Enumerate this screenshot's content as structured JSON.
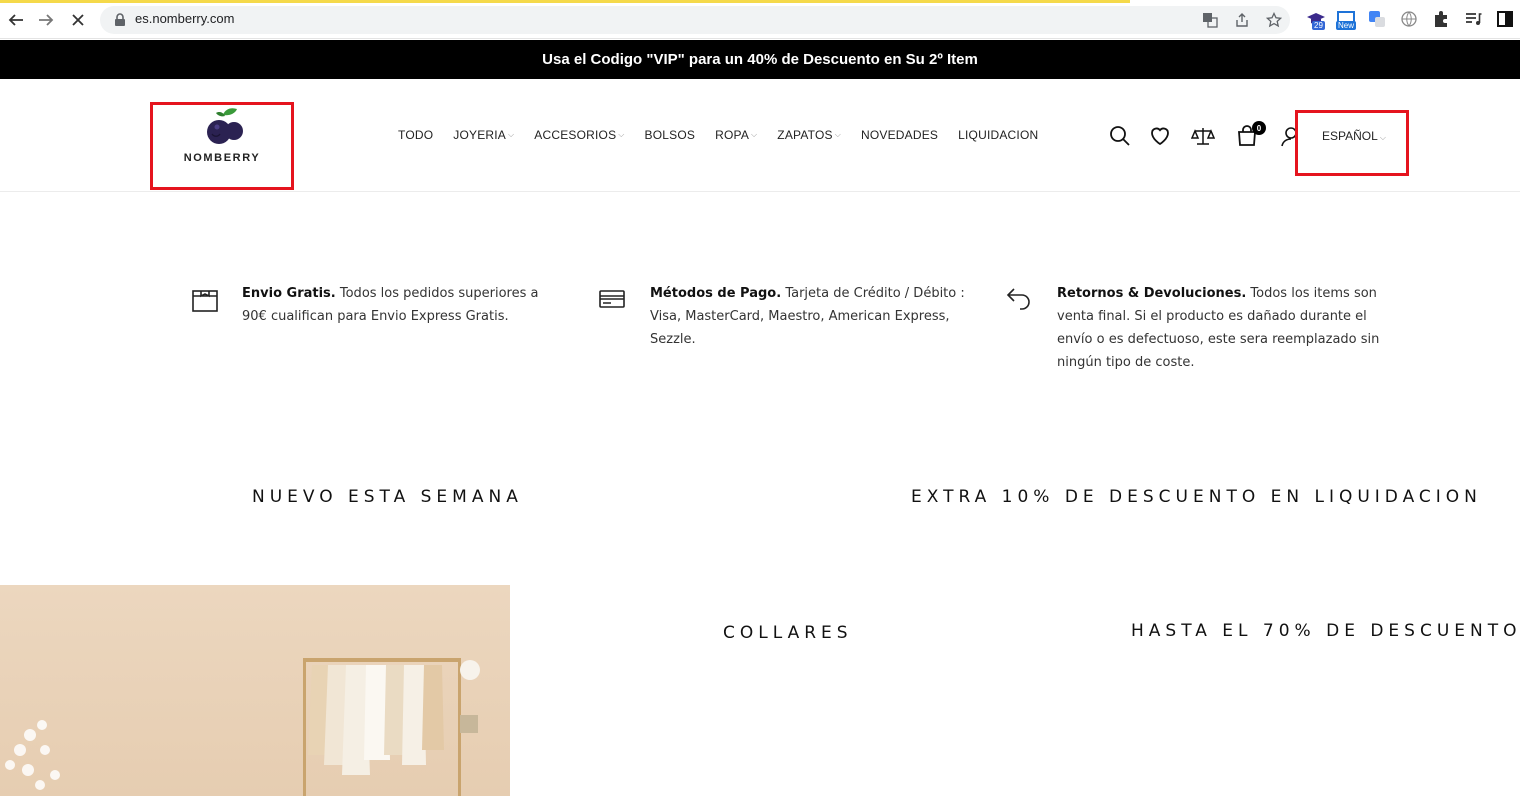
{
  "browser": {
    "url": "es.nomberry.com",
    "extension_badges": {
      "count": "29",
      "new": "New"
    }
  },
  "promo": {
    "text": "Usa el Codigo \"VIP\" para un 40% de Descuento en Su 2º Item"
  },
  "header": {
    "logo_text": "NOMBERRY",
    "nav": [
      {
        "label": "TODO",
        "has_dropdown": false
      },
      {
        "label": "JOYERIA",
        "has_dropdown": true
      },
      {
        "label": "ACCESORIOS",
        "has_dropdown": true
      },
      {
        "label": "BOLSOS",
        "has_dropdown": false
      },
      {
        "label": "ROPA",
        "has_dropdown": true
      },
      {
        "label": "ZAPATOS",
        "has_dropdown": true
      },
      {
        "label": "NOVEDADES",
        "has_dropdown": false
      },
      {
        "label": "LIQUIDACION",
        "has_dropdown": false
      }
    ],
    "cart_count": "0",
    "language": "ESPAÑOL",
    "highlight_color": "#e5141e"
  },
  "features": [
    {
      "icon": "box-icon",
      "title": "Envio Gratis.",
      "text": "Todos los pedidos superiores a 90€ cualifican para Envio Express Gratis."
    },
    {
      "icon": "credit-card-icon",
      "title": "Métodos de Pago.",
      "text": "Tarjeta de Crédito / Débito : Visa, MasterCard, Maestro, American Express, Sezzle."
    },
    {
      "icon": "return-arrow-icon",
      "title": "Retornos & Devoluciones.",
      "text": "Todos los items son venta final. Si el producto es dañado durante el envío o es defectuoso, este sera reemplazado sin ningún tipo de coste."
    }
  ],
  "sections": {
    "new_this_week": "NUEVO ESTA SEMANA",
    "extra_discount": "EXTRA 10% DE DESCUENTO EN LIQUIDACION",
    "necklaces": "COLLARES",
    "up_to_discount": "HASTA EL 70% DE DESCUENTO"
  }
}
